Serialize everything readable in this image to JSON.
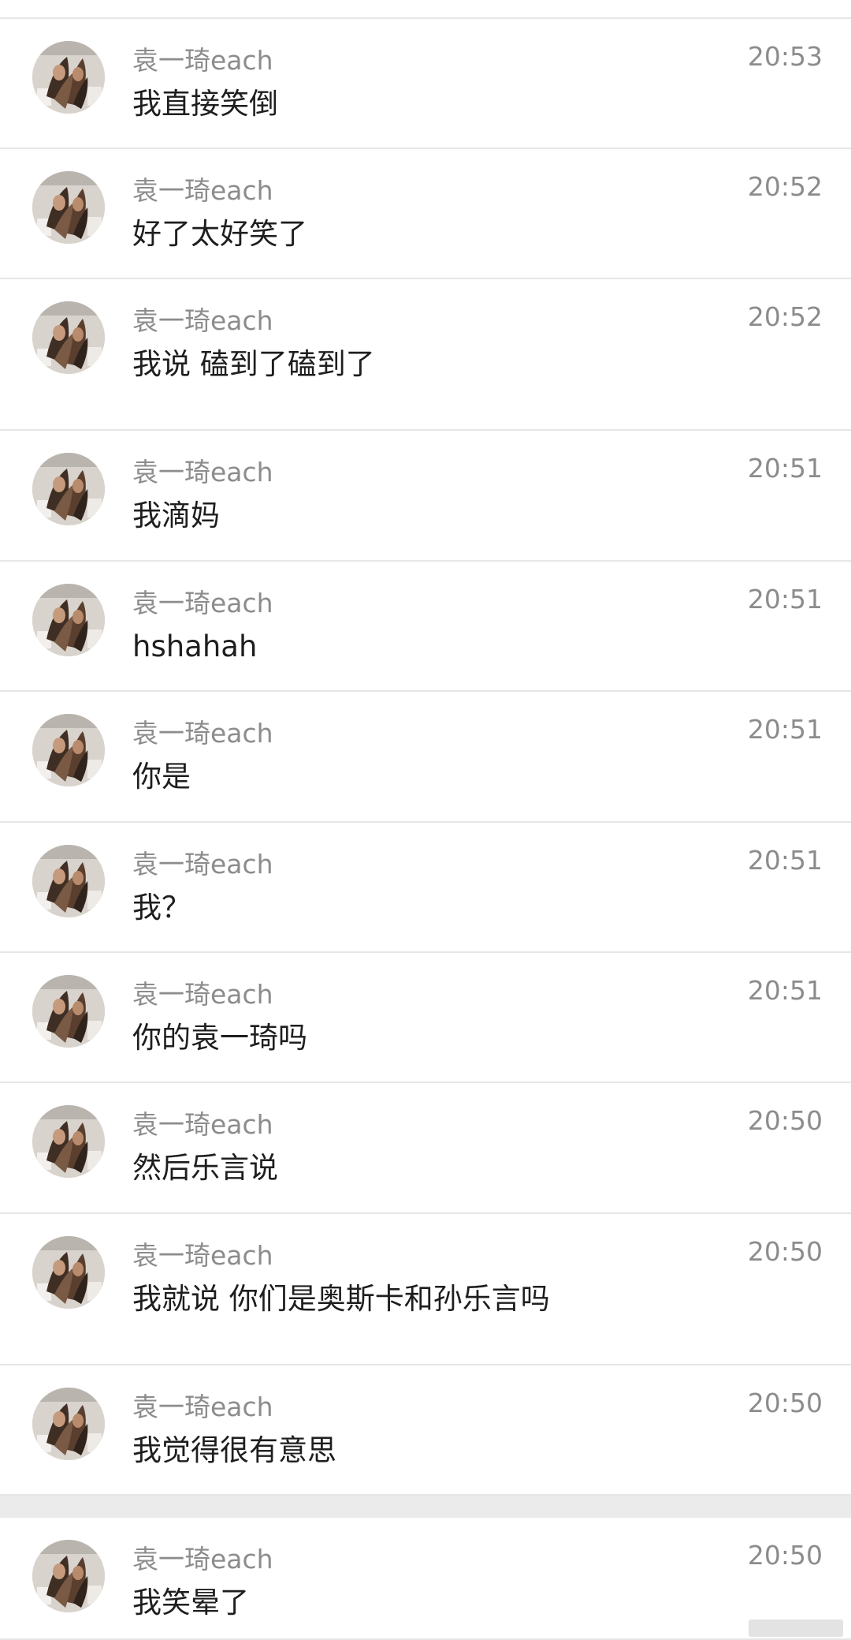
{
  "conversation": {
    "messages": [
      {
        "sender": "袁一琦each",
        "text": "我直接笑倒",
        "time": "20:53"
      },
      {
        "sender": "袁一琦each",
        "text": "好了太好笑了",
        "time": "20:52"
      },
      {
        "sender": "袁一琦each",
        "text": "我说 磕到了磕到了",
        "time": "20:52"
      },
      {
        "sender": "袁一琦each",
        "text": "我滴妈",
        "time": "20:51"
      },
      {
        "sender": "袁一琦each",
        "text": "hshahah",
        "time": "20:51"
      },
      {
        "sender": "袁一琦each",
        "text": "你是",
        "time": "20:51"
      },
      {
        "sender": "袁一琦each",
        "text": "我？",
        "time": "20:51"
      },
      {
        "sender": "袁一琦each",
        "text": "你的袁一琦吗",
        "time": "20:51"
      },
      {
        "sender": "袁一琦each",
        "text": "然后乐言说",
        "time": "20:50"
      },
      {
        "sender": "袁一琦each",
        "text": "我就说 你们是奥斯卡和孙乐言吗",
        "time": "20:50"
      },
      {
        "sender": "袁一琦each",
        "text": "我觉得很有意思",
        "time": "20:50"
      },
      {
        "sender": "袁一琦each",
        "text": "我笑晕了",
        "time": "20:50"
      }
    ]
  },
  "colors": {
    "sender_name": "#8c8c8c",
    "message_text": "#1e1e1e",
    "timestamp": "#8c8c8c",
    "divider": "#e6e6e6",
    "section_gap": "#ebebeb"
  },
  "icons": {
    "avatar": "user-avatar-photo"
  }
}
